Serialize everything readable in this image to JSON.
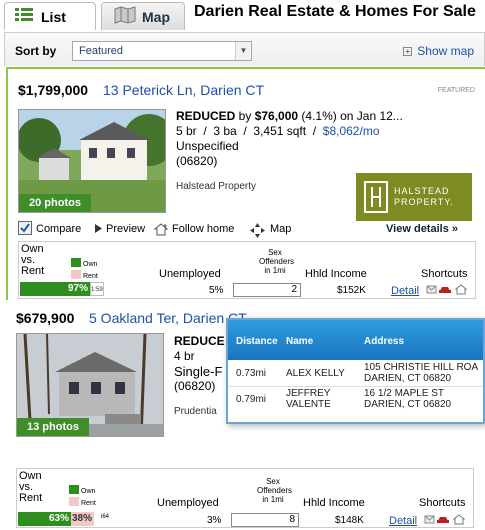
{
  "tabs": {
    "list": "List",
    "map": "Map"
  },
  "page_title": "Darien Real Estate & Homes For Sale",
  "sort": {
    "label": "Sort by",
    "selected": "Featured",
    "show_map": "Show map"
  },
  "listings": [
    {
      "price": "$1,799,000",
      "address": "13 Peterick Ln, Darien CT",
      "featured": "FEATURED",
      "reduced_label": "REDUCED",
      "reduced_by": " by ",
      "reduced_amount": "$76,000",
      "reduced_rest": " (4.1%) on Jan 12...",
      "beds": "5 br",
      "baths": "3 ba",
      "sqft": "3,451 sqft",
      "monthly": "$8,062/mo",
      "neighborhood": "Unspecified",
      "zip": "(06820)",
      "broker": "Halstead Property",
      "photos": "20 photos",
      "logo_text_1": "HALSTEAD",
      "logo_text_2": "PROPERTY.",
      "actions": {
        "compare": "Compare",
        "preview": "Preview",
        "follow": "Follow home",
        "map": "Map",
        "view_details": "View details »"
      },
      "stats": {
        "own_vs_rent_1": "Own",
        "own_vs_rent_2": "vs.",
        "own_vs_rent_3": "Rent",
        "legend_own": "Own",
        "legend_rent": "Rent",
        "own_pct_label": "97%",
        "own_pct": 0.97,
        "rent_pct_label": "1:59",
        "unemployed_label": "Unemployed",
        "unemployed": "5%",
        "sex_off_1": "Sex",
        "sex_off_2": "Offenders",
        "sex_off_3": "in 1mi",
        "sex_off": "2",
        "income_label": "Hhld Income",
        "income": "$152K",
        "shortcuts_label": "Shortcuts",
        "detail": "Detail"
      }
    },
    {
      "price": "$679,900",
      "address": "5 Oakland Ter, Darien CT",
      "reduced_label": "REDUCE",
      "beds": "4 br",
      "type": "Single-F",
      "zip": "(06820)",
      "broker": "Prudentia",
      "photos": "13 photos",
      "stats": {
        "own_vs_rent_1": "Own",
        "own_vs_rent_2": "vs.",
        "own_vs_rent_3": "Rent",
        "legend_own": "Own",
        "legend_rent": "Rent",
        "own_pct_label": "63%",
        "own_pct": 0.63,
        "rent_pct_label": "38%",
        "rent_pct": 0.38,
        "extra_label": "i64",
        "unemployed_label": "Unemployed",
        "unemployed": "3%",
        "sex_off_1": "Sex",
        "sex_off_2": "Offenders",
        "sex_off_3": "in 1mi",
        "sex_off": "8",
        "income_label": "Hhld Income",
        "income": "$148K",
        "shortcuts_label": "Shortcuts",
        "detail": "Detail"
      }
    }
  ],
  "popup": {
    "headers": {
      "distance": "Distance",
      "name": "Name",
      "address": "Address"
    },
    "rows": [
      {
        "distance": "0.73mi",
        "name": "ALEX KELLY",
        "addr1": "105 CHRISTIE HILL ROA",
        "addr2": "DARIEN, CT 06820"
      },
      {
        "distance": "0.79mi",
        "name1": "JEFFREY",
        "name2": "VALENTE",
        "addr1": "16 1/2 MAPLE ST",
        "addr2": "DARIEN, CT 06820"
      }
    ]
  },
  "colors": {
    "accent_green": "#3f8e2a",
    "link_blue": "#1f4fa8",
    "own_bar": "#2e8f1e",
    "rent_bar": "#f1c7c7",
    "popup_header": "#1874bf"
  },
  "icons": [
    "list-icon",
    "map-icon",
    "plus-icon",
    "checkbox-icon",
    "preview-icon",
    "follow-home-icon",
    "map-arrows-icon",
    "mail-icon",
    "car-icon",
    "home-icon"
  ]
}
